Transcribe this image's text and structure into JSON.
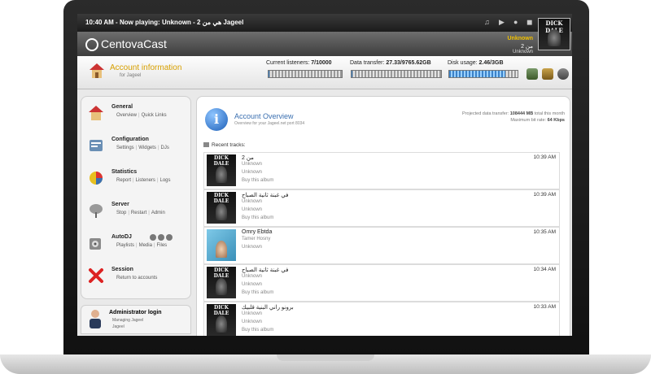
{
  "now_playing": {
    "text": "10:40 AM - Now playing: Unknown - 2 هي من Jageel",
    "artist": "Unknown",
    "song": "من 2",
    "album": "Unknown"
  },
  "logo": {
    "text": "CentovaCast"
  },
  "cover_label": "DICK DALE",
  "account": {
    "title": "Account information",
    "subtitle": "for Jageel"
  },
  "stats": {
    "listeners_label": "Current listeners:",
    "listeners_value": "7/10000",
    "listeners_fraction": 0.0007,
    "transfer_label": "Data transfer:",
    "transfer_value": "27.33/9765.62GB",
    "transfer_fraction": 0.003,
    "disk_label": "Disk usage:",
    "disk_value": "2.46/3GB",
    "disk_fraction": 0.82
  },
  "sidebar": {
    "items": [
      {
        "title": "General",
        "links": [
          "Overview",
          "Quick Links"
        ]
      },
      {
        "title": "Configuration",
        "links": [
          "Settings",
          "Widgets",
          "DJs"
        ]
      },
      {
        "title": "Statistics",
        "links": [
          "Report",
          "Listeners",
          "Logs"
        ]
      },
      {
        "title": "Server",
        "links": [
          "Stop",
          "Restart",
          "Admin"
        ]
      },
      {
        "title": "AutoDJ",
        "links": [
          "Playlists",
          "Media",
          "Files"
        ]
      },
      {
        "title": "Session",
        "links": [
          "Return to accounts"
        ]
      }
    ],
    "admin": {
      "title": "Administrator login",
      "line1": "Managing Jageel",
      "line2": "Jageel"
    }
  },
  "overview": {
    "title": "Account Overview",
    "subtitle": "Overview for your Jageel.net port 8034",
    "projected_label": "Projected data transfer:",
    "projected_value": "108444 MB",
    "projected_suffix": "total this month",
    "bitrate_label": "Maximum bit rate:",
    "bitrate_value": "64 Kbps"
  },
  "recent": {
    "label": "Recent tracks:",
    "tracks": [
      {
        "title": "من 2",
        "artist": "Unknown",
        "album": "Unknown",
        "buy": "Buy this album",
        "time": "10:39 AM"
      },
      {
        "title": "في غبنة ثانية الصباح",
        "artist": "Unknown",
        "album": "Unknown",
        "buy": "Buy this album",
        "time": "10:39 AM"
      },
      {
        "title": "Omry Ebtda",
        "artist": "Tamer Hosny",
        "album": "Unknown",
        "buy": "",
        "time": "10:35 AM"
      },
      {
        "title": "في غبنة ثانية الصباح",
        "artist": "Unknown",
        "album": "Unknown",
        "buy": "Buy this album",
        "time": "10:34 AM"
      },
      {
        "title": "برونو راني البنية قلبيك",
        "artist": "Unknown",
        "album": "Unknown",
        "buy": "Buy this album",
        "time": "10:33 AM"
      }
    ]
  },
  "colors": {
    "accent_gold": "#d8a000",
    "link_blue": "#3a6fb0",
    "meter_blue": "#3b82c8"
  }
}
